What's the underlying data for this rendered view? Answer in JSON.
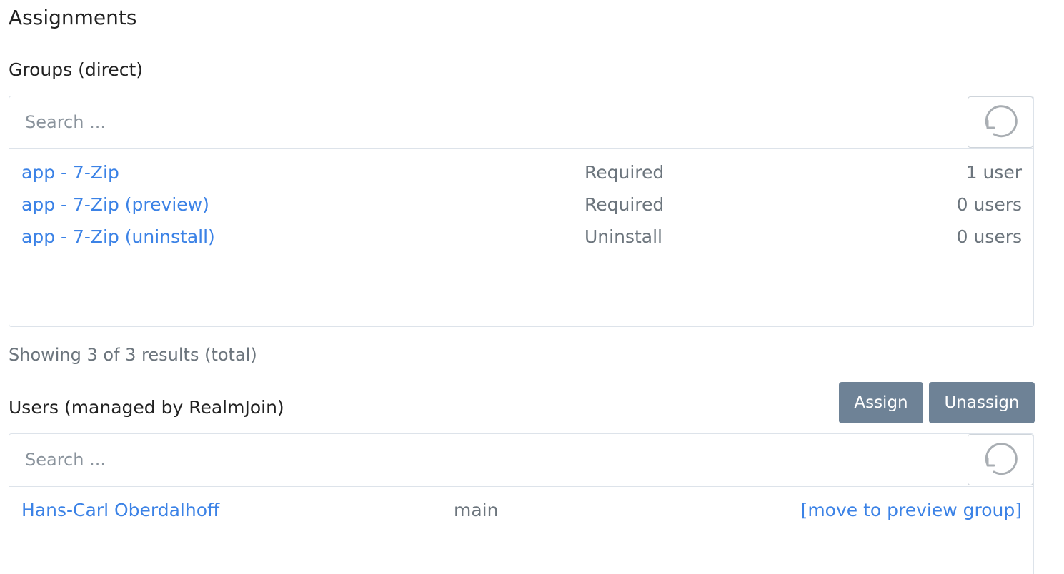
{
  "page": {
    "title": "Assignments"
  },
  "groups": {
    "heading": "Groups (direct)",
    "search_placeholder": "Search ...",
    "items": [
      {
        "name": "app - 7-Zip",
        "type": "Required",
        "count": "1 user"
      },
      {
        "name": "app - 7-Zip (preview)",
        "type": "Required",
        "count": "0 users"
      },
      {
        "name": "app - 7-Zip (uninstall)",
        "type": "Uninstall",
        "count": "0 users"
      }
    ],
    "summary": "Showing 3 of 3 results (total)"
  },
  "users": {
    "heading": "Users (managed by RealmJoin)",
    "assign_label": "Assign",
    "unassign_label": "Unassign",
    "search_placeholder": "Search ...",
    "items": [
      {
        "name": "Hans-Carl Oberdalhoff",
        "group": "main",
        "action": "[move to preview group]"
      }
    ]
  },
  "icons": {
    "refresh": "refresh-icon"
  },
  "colors": {
    "link": "#3b82e6",
    "button": "#6e8296",
    "muted": "#6c757d"
  }
}
